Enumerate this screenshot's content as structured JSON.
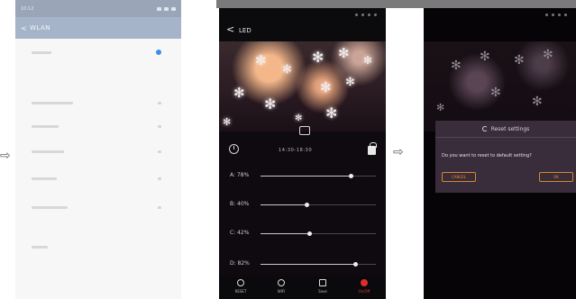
{
  "screen_wlan": {
    "status_time": "10:12",
    "header_title": "WLAN",
    "back_glyph": "<"
  },
  "screen_led": {
    "header_title": "LED",
    "back_glyph": "<",
    "time_range": "14:30-18:30",
    "channels": [
      {
        "label": "A: 78%",
        "value": 78
      },
      {
        "label": "B: 40%",
        "value": 40
      },
      {
        "label": "C: 42%",
        "value": 42
      },
      {
        "label": "D: 82%",
        "value": 82
      }
    ],
    "nav": [
      {
        "label": "RESET",
        "icon": "reset-icon"
      },
      {
        "label": "WIFI",
        "icon": "wifi-icon"
      },
      {
        "label": "Save",
        "icon": "save-icon"
      },
      {
        "label": "On/Off",
        "icon": "power-icon",
        "accent": "#e02c2c"
      }
    ]
  },
  "screen_reset": {
    "dialog_title": "Reset settings",
    "dialog_message": "Do you want to reset to default setting?",
    "cancel_label": "CANCEL",
    "ok_label": "OK",
    "accent": "#d9882a"
  },
  "arrows": [
    "⇨",
    "⇨"
  ]
}
